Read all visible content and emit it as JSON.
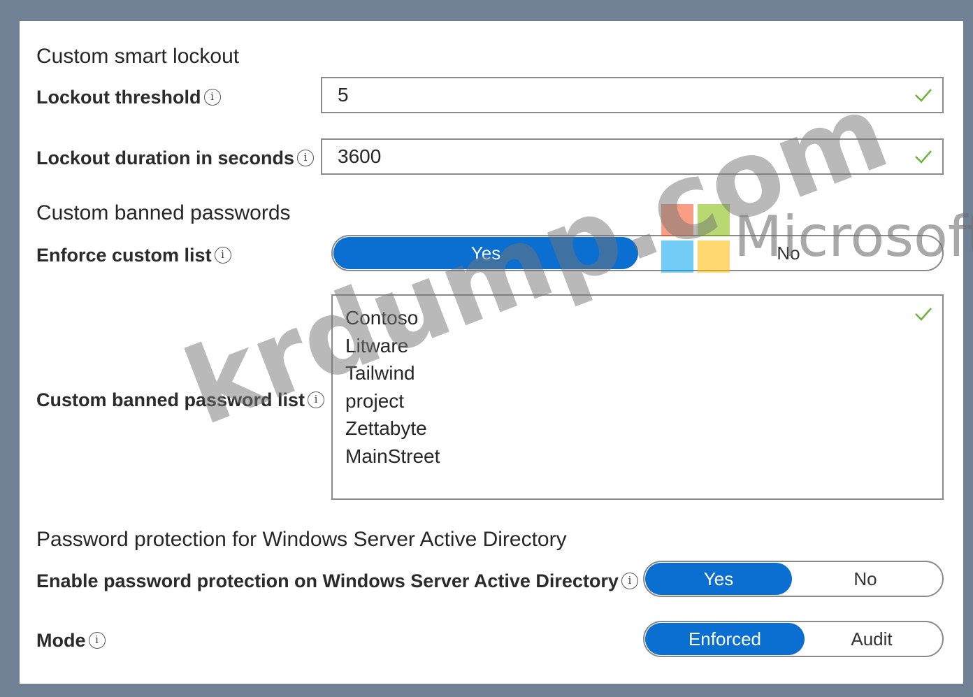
{
  "smart_lockout": {
    "title": "Custom smart lockout",
    "threshold_label": "Lockout threshold",
    "threshold_value": "5",
    "duration_label": "Lockout duration in seconds",
    "duration_value": "3600"
  },
  "banned_passwords": {
    "title": "Custom banned passwords",
    "enforce_label": "Enforce custom list",
    "enforce_yes": "Yes",
    "enforce_no": "No",
    "enforce_selected": "Yes",
    "list_label": "Custom banned password list",
    "list_items": [
      "Contoso",
      "Litware",
      "Tailwind",
      "project",
      "Zettabyte",
      "MainStreet"
    ]
  },
  "windows_protection": {
    "title": "Password protection for Windows Server Active Directory",
    "enable_label": "Enable password protection on Windows Server Active Directory",
    "enable_yes": "Yes",
    "enable_no": "No",
    "enable_selected": "Yes",
    "mode_label": "Mode",
    "mode_enforced": "Enforced",
    "mode_audit": "Audit",
    "mode_selected": "Enforced"
  },
  "icons": {
    "info": "info-icon",
    "check": "checkmark-icon"
  },
  "watermarks": {
    "site": "krdump.com",
    "brand": "Microsoft"
  },
  "colors": {
    "accent": "#0a6fd0",
    "check": "#6cb33f",
    "frame": "#6f8193"
  }
}
